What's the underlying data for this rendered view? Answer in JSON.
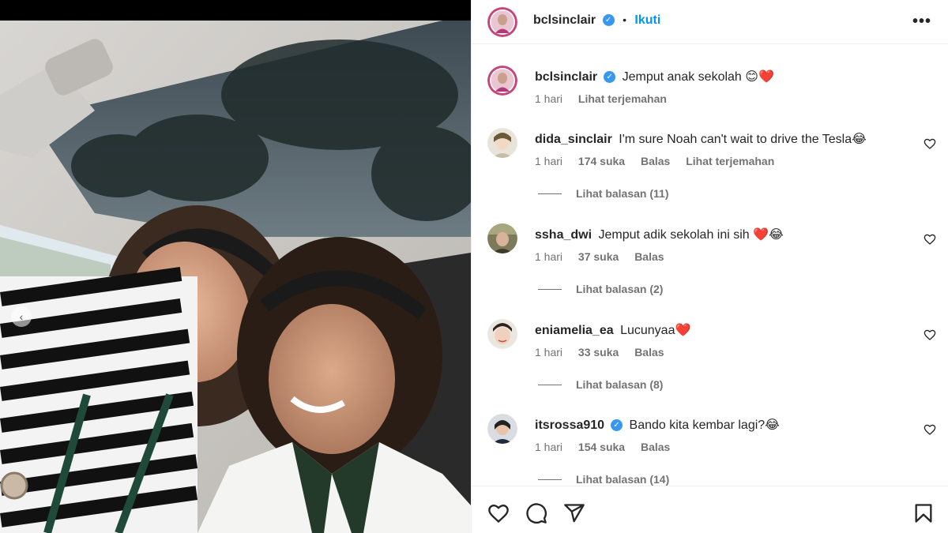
{
  "post": {
    "author": "bclsinclair",
    "follow_label": "Ikuti",
    "dot": "•",
    "more_icon": "•••",
    "carousel_prev": "‹"
  },
  "caption": {
    "username": "bclsinclair",
    "text": "Jemput anak sekolah 😊❤️",
    "time": "1 hari",
    "translate": "Lihat terjemahan"
  },
  "comments": [
    {
      "username": "dida_sinclair",
      "verified": false,
      "text": "I'm sure Noah can't wait to drive the Tesla😂",
      "time": "1 hari",
      "likes": "174 suka",
      "reply": "Balas",
      "translate": "Lihat terjemahan",
      "replies": "Lihat balasan (11)"
    },
    {
      "username": "ssha_dwi",
      "verified": false,
      "text": "Jemput adik sekolah ini sih ❤️😂",
      "time": "1 hari",
      "likes": "37 suka",
      "reply": "Balas",
      "replies": "Lihat balasan (2)"
    },
    {
      "username": "eniamelia_ea",
      "verified": false,
      "text": "Lucunyaa❤️",
      "time": "1 hari",
      "likes": "33 suka",
      "reply": "Balas",
      "replies": "Lihat balasan (8)"
    },
    {
      "username": "itsrossa910",
      "verified": true,
      "text": "Bando kita kembar lagi?😂",
      "time": "1 hari",
      "likes": "154 suka",
      "reply": "Balas",
      "replies": "Lihat balasan (14)"
    }
  ],
  "icons": {
    "verified": "✓",
    "heart": "heart-icon",
    "comment": "comment-icon",
    "share": "share-icon",
    "save": "bookmark-icon"
  },
  "colors": {
    "accent": "#0095f6",
    "verified": "#3897f0",
    "muted": "#737373",
    "text": "#262626"
  }
}
